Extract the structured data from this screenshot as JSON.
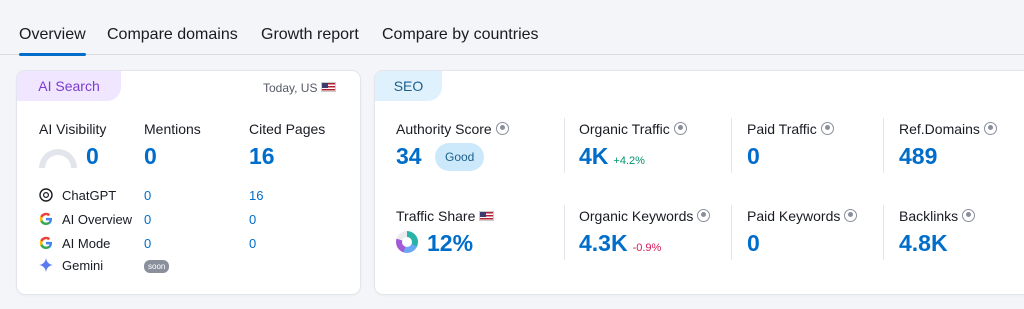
{
  "tabs": [
    {
      "label": "Overview",
      "active": true
    },
    {
      "label": "Compare domains"
    },
    {
      "label": "Growth report"
    },
    {
      "label": "Compare by countries"
    }
  ],
  "ai_card": {
    "tag": "AI Search",
    "date": "Today, US",
    "metrics": [
      {
        "label": "AI Visibility",
        "value": "0"
      },
      {
        "label": "Mentions",
        "value": "0"
      },
      {
        "label": "Cited Pages",
        "value": "16"
      }
    ],
    "rows": [
      {
        "name": "ChatGPT",
        "icon": "chatgpt-icon",
        "mentions": "0",
        "cited": "16"
      },
      {
        "name": "AI Overview",
        "icon": "google-icon",
        "mentions": "0",
        "cited": "0"
      },
      {
        "name": "AI Mode",
        "icon": "google-icon",
        "mentions": "0",
        "cited": "0"
      },
      {
        "name": "Gemini",
        "icon": "gemini-icon",
        "badge": "soon"
      }
    ]
  },
  "seo_card": {
    "tag": "SEO",
    "metrics": [
      {
        "label": "Authority Score",
        "value": "34",
        "badge": "Good"
      },
      {
        "label": "Organic Traffic",
        "value": "4K",
        "delta": "+4.2%"
      },
      {
        "label": "Paid Traffic",
        "value": "0"
      },
      {
        "label": "Ref.Domains",
        "value": "489"
      },
      {
        "label": "Traffic Share",
        "value": "12%"
      },
      {
        "label": "Organic Keywords",
        "value": "4.3K",
        "delta": "-0.9%"
      },
      {
        "label": "Paid Keywords",
        "value": "0"
      },
      {
        "label": "Backlinks",
        "value": "4.8K"
      }
    ]
  },
  "colors": {
    "accent": "#006dca",
    "positive": "#00946a",
    "negative": "#d1185a",
    "ai_tag_bg": "#f1e6ff",
    "seo_tag_bg": "#dff1fc"
  }
}
